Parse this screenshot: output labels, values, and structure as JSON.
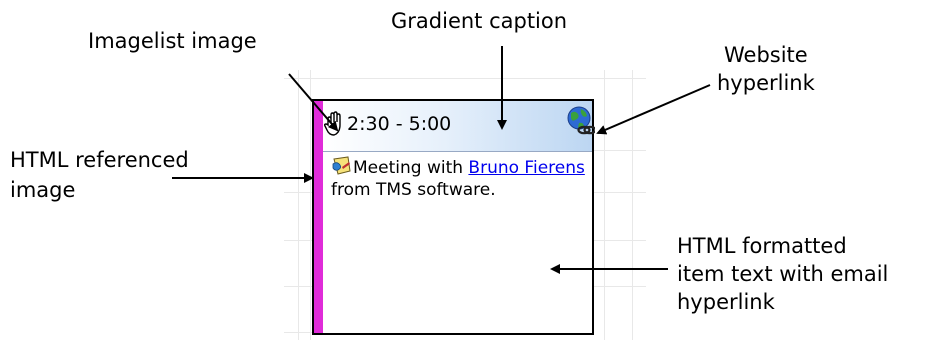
{
  "annotations": {
    "imagelist_image": "Imagelist image",
    "gradient_caption": "Gradient caption",
    "website_hyperlink_line1": "Website",
    "website_hyperlink_line2": "hyperlink",
    "html_image_line1": "HTML referenced",
    "html_image_line2": "image",
    "html_text_line1": "HTML formatted",
    "html_text_line2": "item text with email",
    "html_text_line3": "hyperlink"
  },
  "item": {
    "time_range": "2:30 - 5:00",
    "caption_icon": "hand-icon",
    "link_icon": "globe-link-icon",
    "body_icon": "note-icon",
    "text_before": "Meeting with ",
    "link_name": "Bruno Fierens",
    "text_after": " from TMS software.",
    "accent_color": "#e02bd9",
    "link_color": "#0000ee"
  }
}
